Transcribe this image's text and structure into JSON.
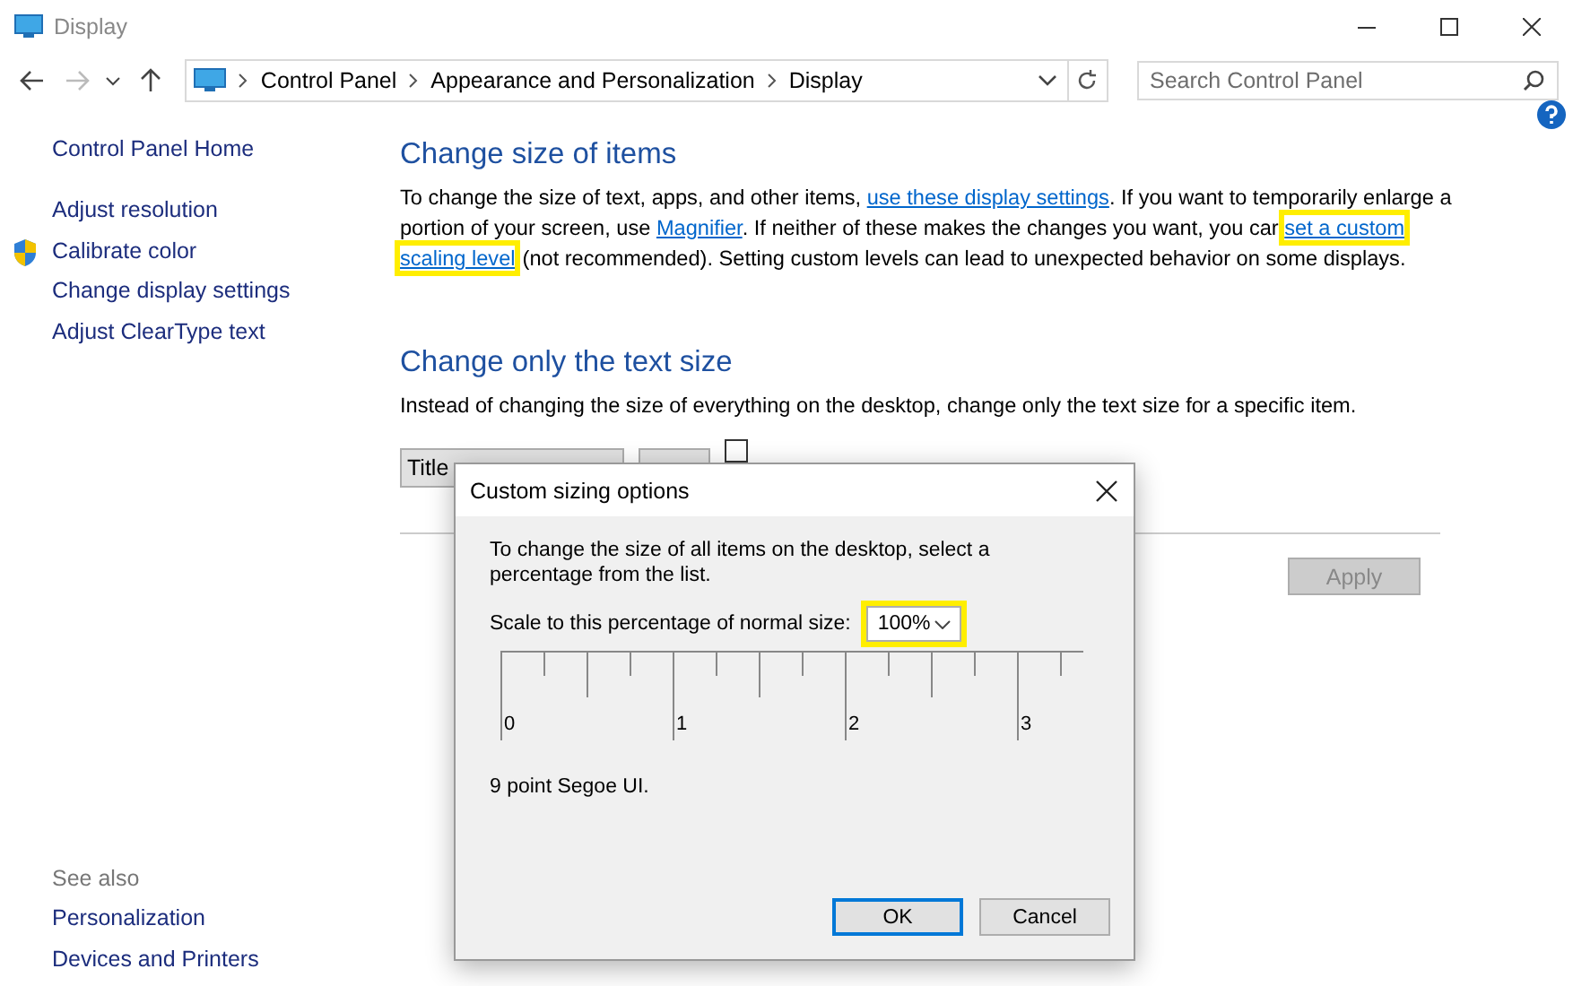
{
  "window": {
    "title": "Display"
  },
  "address_bar": {
    "crumbs": [
      "Control Panel",
      "Appearance and Personalization",
      "Display"
    ]
  },
  "search": {
    "placeholder": "Search Control Panel"
  },
  "sidebar": {
    "items": [
      "Control Panel Home",
      "Adjust resolution",
      "Calibrate color",
      "Change display settings",
      "Adjust ClearType text"
    ],
    "see_also_title": "See also",
    "see_also": [
      "Personalization",
      "Devices and Printers"
    ]
  },
  "sections": [
    {
      "heading": "Change size of items",
      "paragraph": [
        {
          "kind": "text",
          "text": "To change the size of text, apps, and other items, "
        },
        {
          "kind": "link",
          "text": "use these display settings"
        },
        {
          "kind": "text",
          "text": ".  If you want to temporarily enlarge a portion of your screen, use "
        },
        {
          "kind": "link",
          "text": "Magnifier"
        },
        {
          "kind": "text",
          "text": ".  If neither of these makes the changes you want, you car"
        },
        {
          "kind": "highlighted_link",
          "text": "set a custom"
        },
        {
          "kind": "highlighted_link",
          "text": "scaling level"
        },
        {
          "kind": "text",
          "text": "(not recommended).  Setting custom levels can lead to unexpected behavior on some displays."
        }
      ]
    },
    {
      "heading": "Change only the text size",
      "paragraph": [
        {
          "kind": "text",
          "text": "Instead of changing the size of everything on the desktop, change only the text size for a specific item."
        }
      ]
    }
  ],
  "text_size": {
    "item": "Title",
    "bold_checked": false
  },
  "apply_button": {
    "label": "Apply",
    "disabled": true
  },
  "dialog": {
    "title": "Custom sizing options",
    "instructions": "To change the size of all items on the desktop, select a percentage from the list.",
    "scale_label": "Scale to this percentage of normal size:",
    "scale_value": "100%",
    "ruler_labels": [
      "0",
      "1",
      "2",
      "3"
    ],
    "font_note": "9 point Segoe UI.",
    "buttons": [
      {
        "label": "OK",
        "default": true
      },
      {
        "label": "Cancel",
        "default": false
      }
    ]
  }
}
